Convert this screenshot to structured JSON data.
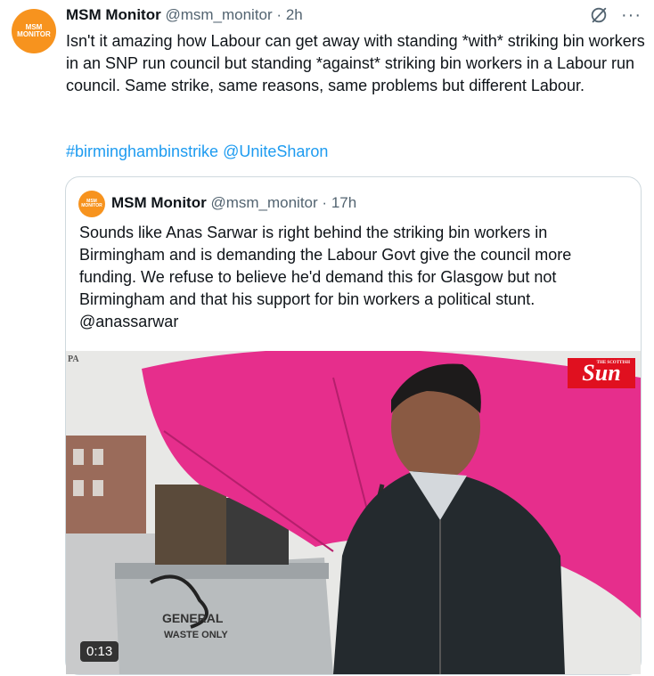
{
  "tweet": {
    "avatar_text_line1": "MSM",
    "avatar_text_line2": "MONITOR",
    "author_name": "MSM Monitor",
    "handle": "@msm_monitor",
    "separator": "·",
    "time": "2h",
    "text": "Isn't it amazing how Labour can get away with standing *with* striking bin workers in an SNP run council but standing *against* striking bin workers in a Labour run council. Same strike, same reasons, same problems but different Labour.",
    "hashtag": "#birminghambinstrike",
    "mention": "@UniteSharon",
    "grok_icon": "grok-icon",
    "more_icon": "more-icon",
    "more_label": "···"
  },
  "quoted": {
    "avatar_text_line1": "MSM",
    "avatar_text_line2": "MONITOR",
    "author_name": "MSM Monitor",
    "handle": "@msm_monitor",
    "separator": "·",
    "time": "17h",
    "text": "Sounds like Anas Sarwar is right behind the striking bin workers in Birmingham and is demanding the Labour Govt give the council more funding. We refuse to believe he'd demand this for Glasgow but not Birmingham and that his support for bin workers a political stunt.",
    "mention": "@anassarwar",
    "video": {
      "duration": "0:13",
      "pa_label": "PA",
      "sun_label": "Sun",
      "sun_small": "THE SCOTTISH",
      "bin_text_1": "GENERAL",
      "bin_text_2": "WASTE ONLY"
    }
  },
  "colors": {
    "accent": "#1d9bf0",
    "avatar": "#f7931e",
    "umbrella": "#e62e8c",
    "sun_red": "#e0101f"
  }
}
